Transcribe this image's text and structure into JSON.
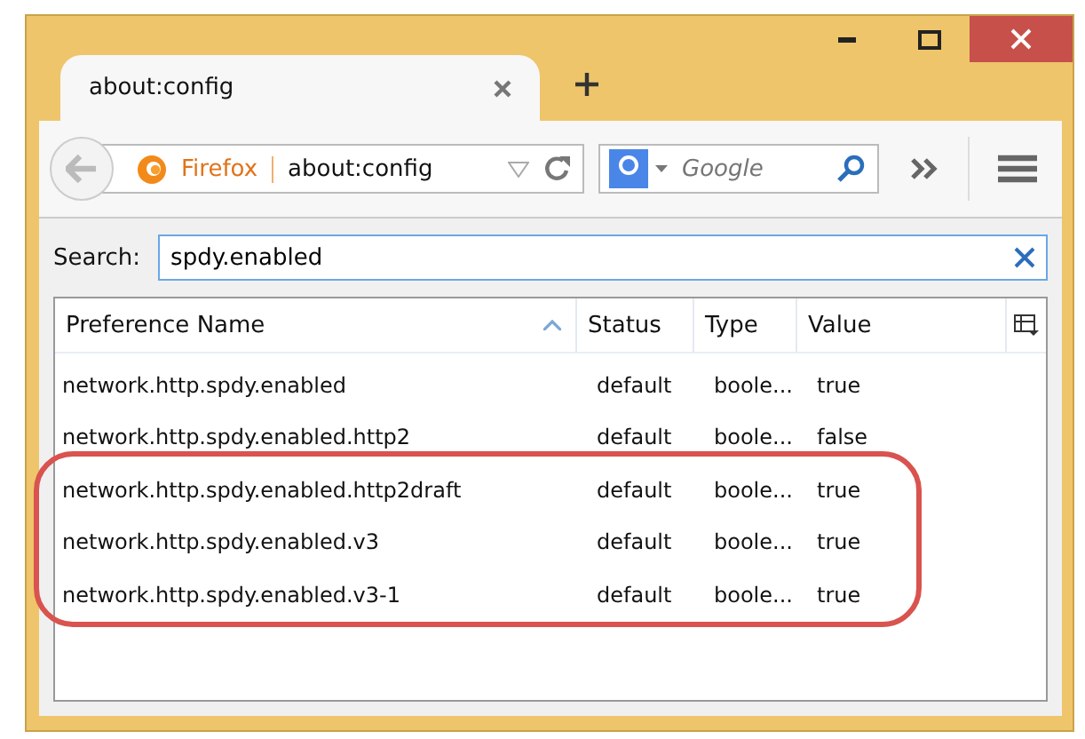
{
  "tab": {
    "title": "about:config",
    "selected": true
  },
  "url_bar": {
    "identity": "Firefox",
    "url": "about:config"
  },
  "search_bar": {
    "placeholder": "Google"
  },
  "search": {
    "label": "Search:",
    "value": "spdy.enabled"
  },
  "table": {
    "columns": [
      {
        "label": "Preference Name",
        "sorted": true
      },
      {
        "label": "Status",
        "sorted": false
      },
      {
        "label": "Type",
        "sorted": false
      },
      {
        "label": "Value",
        "sorted": false
      }
    ],
    "rows": [
      {
        "name": "network.http.spdy.enabled",
        "status": "default",
        "type": "boole...",
        "value": "true",
        "highlighted": false
      },
      {
        "name": "network.http.spdy.enabled.http2",
        "status": "default",
        "type": "boole...",
        "value": "false",
        "highlighted": false
      },
      {
        "name": "network.http.spdy.enabled.http2draft",
        "status": "default",
        "type": "boole...",
        "value": "true",
        "highlighted": true
      },
      {
        "name": "network.http.spdy.enabled.v3",
        "status": "default",
        "type": "boole...",
        "value": "true",
        "highlighted": true
      },
      {
        "name": "network.http.spdy.enabled.v3-1",
        "status": "default",
        "type": "boole...",
        "value": "true",
        "highlighted": true
      }
    ]
  }
}
